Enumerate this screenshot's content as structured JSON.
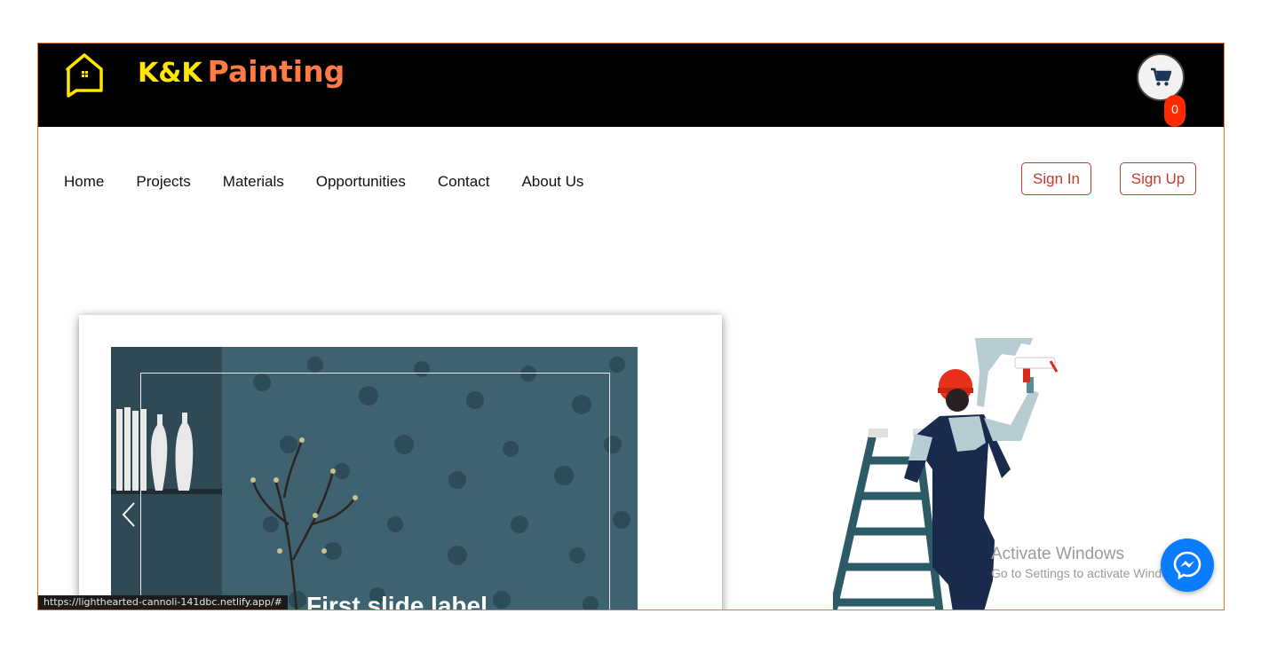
{
  "header": {
    "brand_prefix": "K&K",
    "brand_name": "Painting",
    "cart_count": "0"
  },
  "nav": {
    "items": [
      {
        "label": "Home"
      },
      {
        "label": "Projects"
      },
      {
        "label": "Materials"
      },
      {
        "label": "Opportunities"
      },
      {
        "label": "Contact"
      },
      {
        "label": "About Us"
      }
    ]
  },
  "auth": {
    "sign_in": "Sign In",
    "sign_up": "Sign Up"
  },
  "carousel": {
    "slide_label": "First slide label"
  },
  "status_bar": {
    "url": "https://lighthearted-cannoli-141dbc.netlify.app/#"
  },
  "watermark": {
    "title": "Activate Windows",
    "subtitle": "Go to Settings to activate Windows."
  },
  "colors": {
    "header_bg": "#000000",
    "brand_yellow": "#ffe600",
    "brand_orange": "#ff7a45",
    "accent_red": "#c0392b",
    "cart_badge": "#ff2a00",
    "messenger_blue": "#0a7cff"
  },
  "icons": {
    "logo": "house-icon",
    "cart": "shopping-cart-icon",
    "prev": "chevron-left-icon",
    "chat": "messenger-icon"
  }
}
